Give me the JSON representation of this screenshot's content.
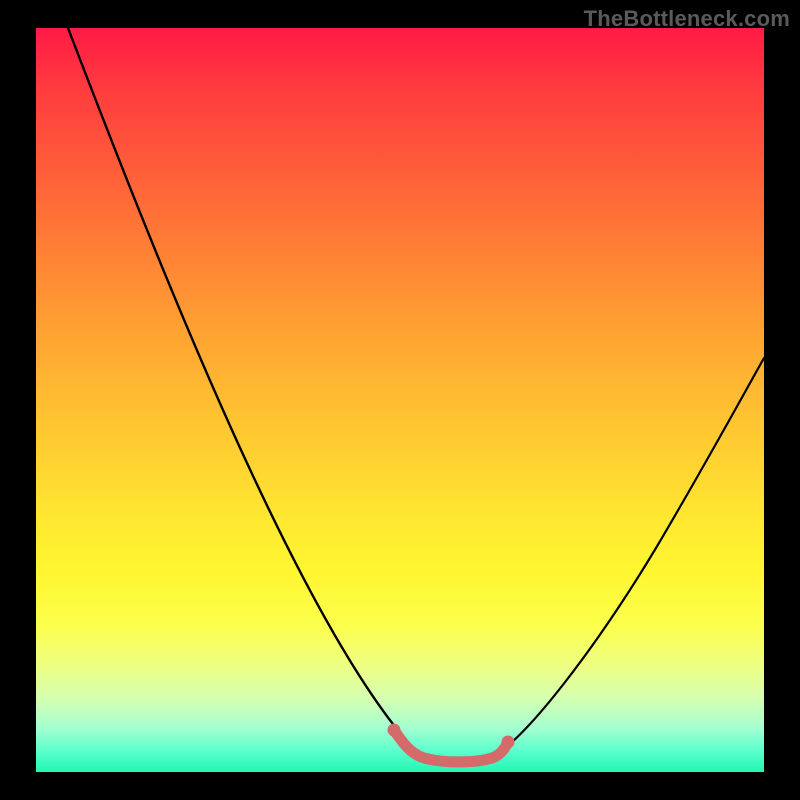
{
  "watermark": "TheBottleneck.com",
  "colors": {
    "background": "#000000",
    "curve": "#000000",
    "curve_highlight": "#d46a6a",
    "gradient_top": "#ff1a46",
    "gradient_bottom": "#20f7b3"
  },
  "chart_data": {
    "type": "line",
    "title": "",
    "xlabel": "",
    "ylabel": "",
    "xlim": [
      0,
      100
    ],
    "ylim": [
      0,
      100
    ],
    "grid": false,
    "legend": false,
    "series": [
      {
        "name": "bottleneck-curve",
        "x": [
          0,
          5,
          10,
          15,
          20,
          25,
          30,
          35,
          40,
          45,
          50,
          52,
          55,
          58,
          60,
          65,
          70,
          75,
          80,
          85,
          90,
          95,
          100
        ],
        "y": [
          100,
          91,
          82,
          73,
          64,
          55,
          46,
          37,
          28,
          19,
          9,
          4,
          0,
          0,
          0,
          4,
          12,
          20,
          28,
          36,
          44,
          52,
          60
        ]
      },
      {
        "name": "highlight-segment",
        "x": [
          50,
          52,
          54,
          56,
          58,
          60,
          62
        ],
        "y": [
          5,
          2,
          0,
          0,
          0,
          1,
          4
        ]
      }
    ],
    "annotations": []
  }
}
